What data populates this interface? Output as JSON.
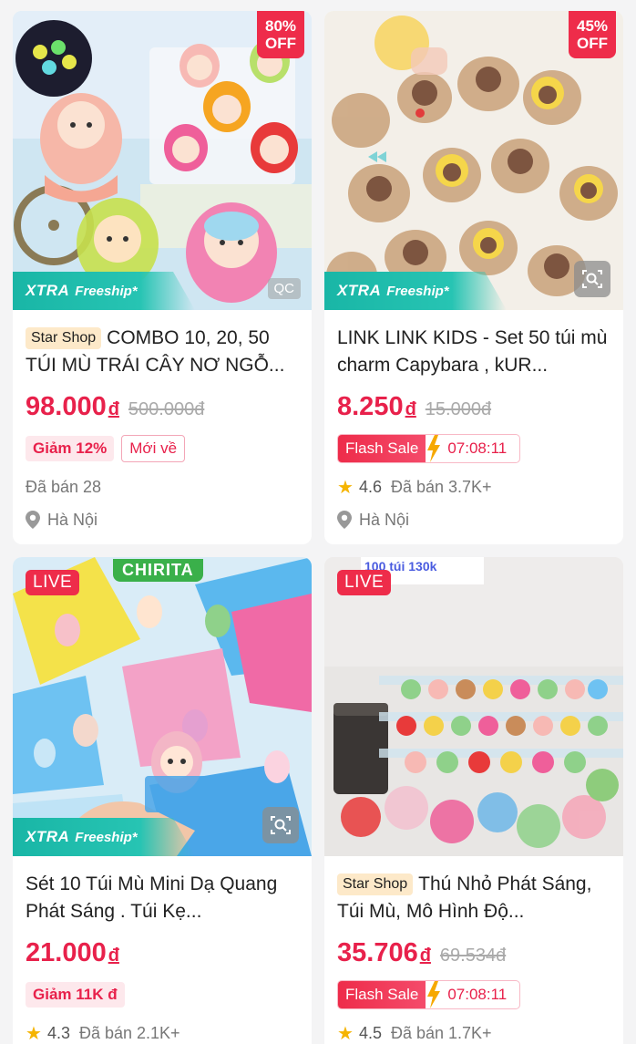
{
  "products": [
    {
      "discount_percent": "80%",
      "discount_off": "OFF",
      "xtra": "XTRA",
      "freeship": "Freeship*",
      "ad_label": "QC",
      "shop_badge": "Star Shop",
      "title": "COMBO 10, 20, 50 TÚI MÙ TRÁI CÂY NƠ NGỖ...",
      "price": "98.000",
      "currency": "đ",
      "old_price": "500.000đ",
      "tag1": "Giảm 12%",
      "tag2": "Mới về",
      "sold": "Đã bán 28",
      "location": "Hà Nội"
    },
    {
      "discount_percent": "45%",
      "discount_off": "OFF",
      "xtra": "XTRA",
      "freeship": "Freeship*",
      "title": "LINK LINK KIDS - Set 50 túi mù charm Capybara , kUR...",
      "price": "8.250",
      "currency": "đ",
      "old_price": "15.000đ",
      "flash_label": "Flash Sale",
      "timer": "07:08:11",
      "rating": "4.6",
      "sold": "Đã bán 3.7K+",
      "location": "Hà Nội"
    },
    {
      "live": "LIVE",
      "brand_label": "CHIRITA",
      "xtra": "XTRA",
      "freeship": "Freeship*",
      "title": "Sét 10 Túi Mù Mini Dạ Quang Phát Sáng . Túi Kẹ...",
      "price": "21.000",
      "currency": "đ",
      "tag1": "Giảm 11K đ",
      "rating": "4.3",
      "sold": "Đã bán 2.1K+"
    },
    {
      "live": "LIVE",
      "banner_text": "100 túi 130k",
      "shop_badge": "Star Shop",
      "title": "Thú Nhỏ Phát Sáng, Túi Mù, Mô Hình Độ...",
      "price": "35.706",
      "currency": "đ",
      "old_price": "69.534đ",
      "flash_label": "Flash Sale",
      "timer": "07:08:11",
      "rating": "4.5",
      "sold": "Đã bán 1.7K+"
    }
  ],
  "colors": {
    "accent": "#e8214b",
    "xtra_teal": "#19b6a6",
    "star": "#f5b400",
    "shop_badge_bg": "#fde9c9"
  }
}
